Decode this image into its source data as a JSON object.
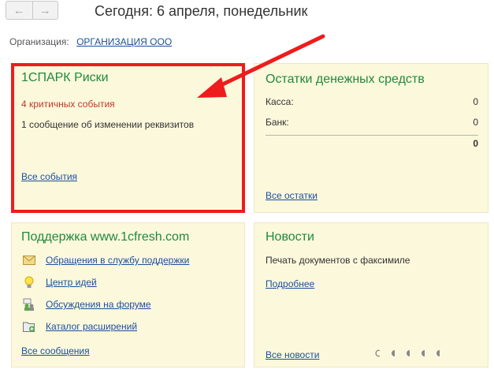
{
  "header": {
    "title": "Сегодня: 6 апреля, понедельник",
    "back_icon": "arrow-left-icon",
    "forward_icon": "arrow-right-icon"
  },
  "organization": {
    "label": "Организация:",
    "value": "ОРГАНИЗАЦИЯ ООО"
  },
  "spark": {
    "title": "1СПАРК Риски",
    "critical": "4 критичных события",
    "requisites": "1 сообщение об изменении реквизитов",
    "all_link": "Все события"
  },
  "balances": {
    "title": "Остатки денежных средств",
    "rows": [
      {
        "label": "Касса:",
        "value": "0"
      },
      {
        "label": "Банк:",
        "value": "0"
      }
    ],
    "total": "0",
    "all_link": "Все остатки"
  },
  "support": {
    "title": "Поддержка www.1cfresh.com",
    "items": [
      {
        "label": "Обращения в службу поддержки",
        "icon": "envelope-icon"
      },
      {
        "label": "Центр идей",
        "icon": "lightbulb-icon"
      },
      {
        "label": "Обсуждения на форуме",
        "icon": "forum-users-icon"
      },
      {
        "label": "Каталог расширений",
        "icon": "folder-add-icon"
      }
    ],
    "all_link": "Все сообщения"
  },
  "news": {
    "title": "Новости",
    "text": "Печать документов с факсимиле",
    "more_link": "Подробнее",
    "all_link": "Все новости",
    "pager_icons": [
      "pager-dot-empty-icon",
      "pager-dot-icon",
      "pager-dot-icon",
      "pager-dot-icon",
      "pager-dot-icon"
    ]
  },
  "colors": {
    "panel_bg": "#fcf8dc",
    "title_green": "#1e8a3c",
    "link_blue": "#1a4f9c",
    "critical_red": "#c0392b",
    "highlight_red": "#ee1c1c"
  }
}
